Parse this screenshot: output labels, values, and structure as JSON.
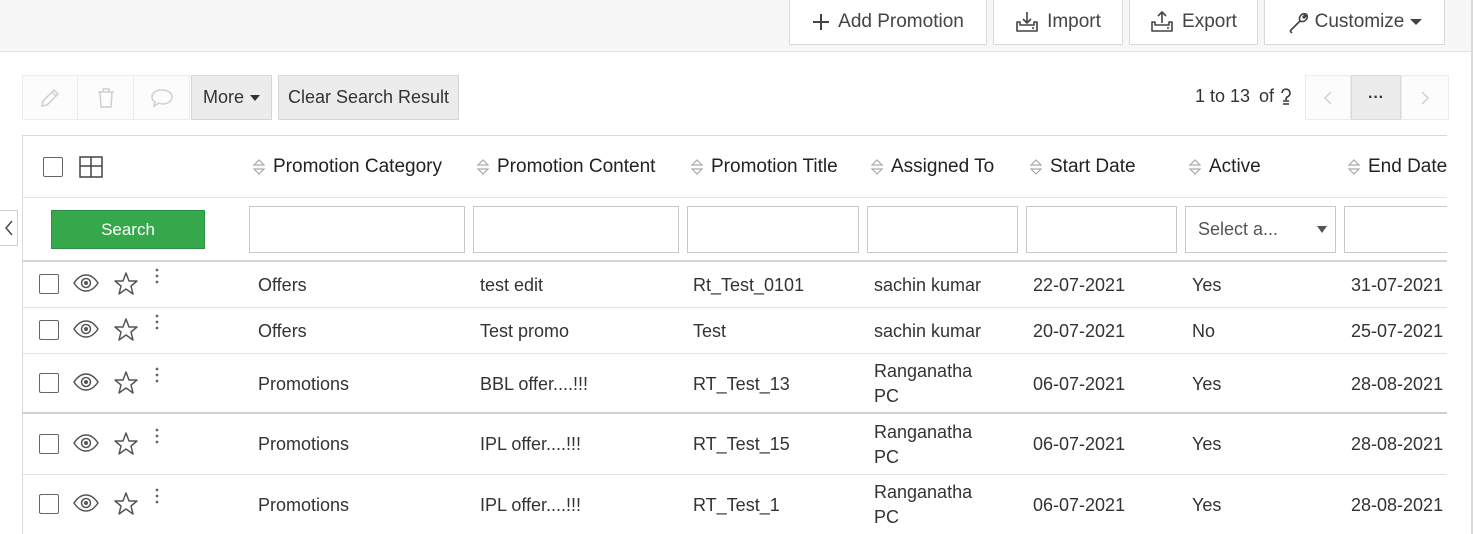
{
  "toolbar": {
    "add_label": "Add Promotion",
    "import_label": "Import",
    "export_label": "Export",
    "customize_label": "Customize"
  },
  "actions": {
    "more_label": "More",
    "clear_label": "Clear Search Result"
  },
  "pager": {
    "range": "1 to 13",
    "of": "of",
    "more": "···"
  },
  "columns": [
    "Promotion Category",
    "Promotion Content",
    "Promotion Title",
    "Assigned To",
    "Start Date",
    "Active",
    "End Date"
  ],
  "search": {
    "button_label": "Search",
    "active_placeholder": "Select a..."
  },
  "rows": [
    {
      "category": "Offers",
      "content": "test edit",
      "title": "Rt_Test_0101",
      "assigned": [
        "sachin kumar"
      ],
      "start": "22-07-2021",
      "active": "Yes",
      "end": "31-07-2021"
    },
    {
      "category": "Offers",
      "content": "Test promo",
      "title": "Test",
      "assigned": [
        "sachin kumar"
      ],
      "start": "20-07-2021",
      "active": "No",
      "end": "25-07-2021"
    },
    {
      "category": "Promotions",
      "content": "BBL offer....!!!",
      "title": "RT_Test_13",
      "assigned": [
        "Ranganatha",
        "PC"
      ],
      "start": "06-07-2021",
      "active": "Yes",
      "end": "28-08-2021"
    },
    {
      "category": "Promotions",
      "content": "IPL offer....!!!",
      "title": "RT_Test_15",
      "assigned": [
        "Ranganatha",
        "PC"
      ],
      "start": "06-07-2021",
      "active": "Yes",
      "end": "28-08-2021"
    },
    {
      "category": "Promotions",
      "content": "IPL offer....!!!",
      "title": "RT_Test_1",
      "assigned": [
        "Ranganatha",
        "PC"
      ],
      "start": "06-07-2021",
      "active": "Yes",
      "end": "28-08-2021"
    }
  ]
}
